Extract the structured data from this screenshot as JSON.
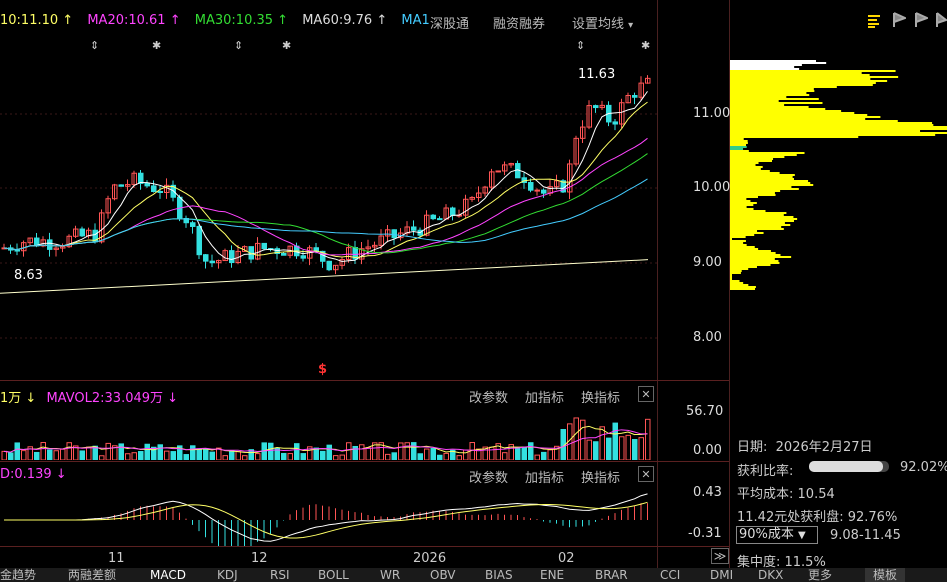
{
  "ma_legend": {
    "ma10": "10:11.10",
    "ma20": "MA20:10.61",
    "ma30": "MA30:10.35",
    "ma60": "MA60:9.76",
    "ma1": "MA1",
    "arrow_up": "↑",
    "colors": {
      "ma10": "#ffff66",
      "ma20": "#ff44ff",
      "ma30": "#33dd33",
      "ma60": "#dddddd",
      "ma1": "#44ccff"
    }
  },
  "top_menu": {
    "shenzhen": "深股通",
    "margin": "融资融券",
    "settings": "设置均线",
    "settings_arrow": "▾"
  },
  "right_icons": [
    "bar-list-icon",
    "flag-icon",
    "flag-right-icon",
    "flag-down-icon"
  ],
  "price_axis": [
    "11.00",
    "10.00",
    "9.00",
    "8.00"
  ],
  "price_labels": {
    "high": "11.63",
    "low": "8.63"
  },
  "volume_legend": {
    "vol": "1万",
    "vol_arrow": "↓",
    "mavol2": "MAVOL2:33.049万",
    "mavol2_arrow": "↓"
  },
  "volume_axis": [
    "56.70",
    "0.00"
  ],
  "macd_legend": {
    "val": "D:0.139",
    "arrow": "↓"
  },
  "macd_axis": [
    "0.43",
    "-0.31"
  ],
  "panel_buttons": {
    "params": "改参数",
    "add_indicator": "加指标",
    "swap_indicator": "换指标",
    "close": "✕"
  },
  "date_axis": [
    "11",
    "12",
    "2026",
    "02"
  ],
  "info_panel": {
    "date_label": "日期:",
    "date_value": "2026年2月27日",
    "profit_ratio_label": "获利比率:",
    "profit_ratio_value": "92.02%",
    "profit_ratio": 0.9202,
    "avg_cost_label": "平均成本:",
    "avg_cost_value": "10.54",
    "profit_line": "11.42元处获利盘: 92.76%",
    "cost_select": "90%成本",
    "cost_range": "9.08-11.45",
    "concentration": "集中度: 11.5%"
  },
  "bottom_tabs": [
    "金趋势",
    "两融差额",
    "MACD",
    "KDJ",
    "RSI",
    "BOLL",
    "WR",
    "OBV",
    "BIAS",
    "ENE",
    "BRAR",
    "CCI",
    "DMI",
    "DKX",
    "更多",
    "模板"
  ],
  "bottom_active_tab": "MACD",
  "expand_icon": "≫",
  "star": "✱",
  "arrows_updown": "⇕",
  "dollar": "$"
}
